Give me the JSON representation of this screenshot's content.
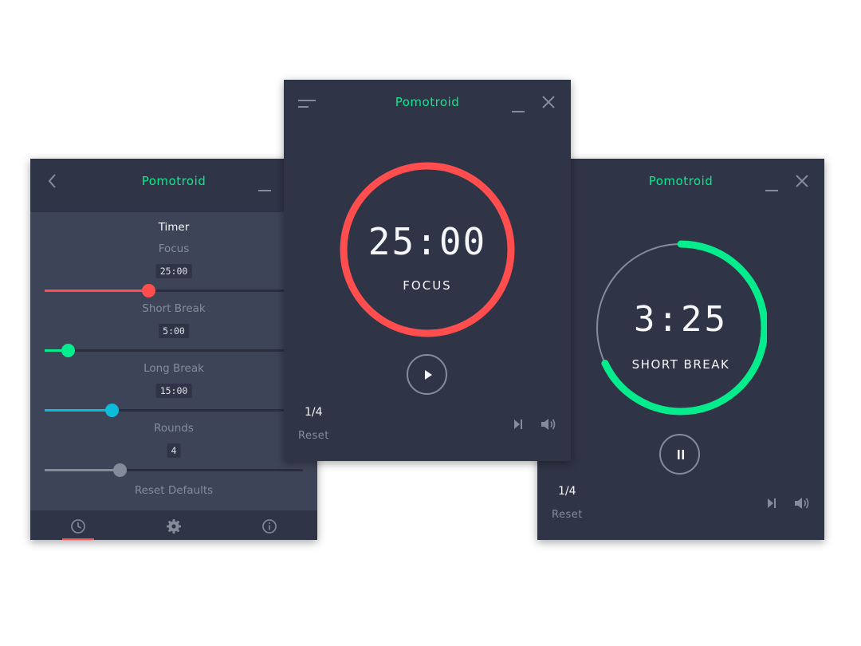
{
  "app": {
    "title": "Pomotroid"
  },
  "colors": {
    "focus": "#ff4e4d",
    "short_break": "#05ec8c",
    "long_break": "#0bbddb",
    "accent_title": "#05ec8c",
    "window_bg": "#2f3446"
  },
  "settings": {
    "heading": "Timer",
    "sliders": [
      {
        "label": "Focus",
        "value": "25:00",
        "level": 0.4,
        "color": "#ff4e4d"
      },
      {
        "label": "Short Break",
        "value": "5:00",
        "level": 0.09,
        "color": "#05ec8c"
      },
      {
        "label": "Long Break",
        "value": "15:00",
        "level": 0.26,
        "color": "#0bbddb"
      },
      {
        "label": "Rounds",
        "value": "4",
        "level": 0.29,
        "color": "#858c99"
      }
    ],
    "reset_defaults": "Reset Defaults",
    "nav_icons": [
      "clock-icon",
      "gear-icon",
      "info-icon"
    ]
  },
  "focus_timer": {
    "time": "25:00",
    "mode": "FOCUS",
    "progress": 1.0,
    "round": "1/4",
    "reset": "Reset",
    "control": "play"
  },
  "break_timer": {
    "time": "3:25",
    "mode": "SHORT BREAK",
    "progress": 0.68,
    "round": "1/4",
    "reset": "Reset",
    "control": "pause"
  }
}
